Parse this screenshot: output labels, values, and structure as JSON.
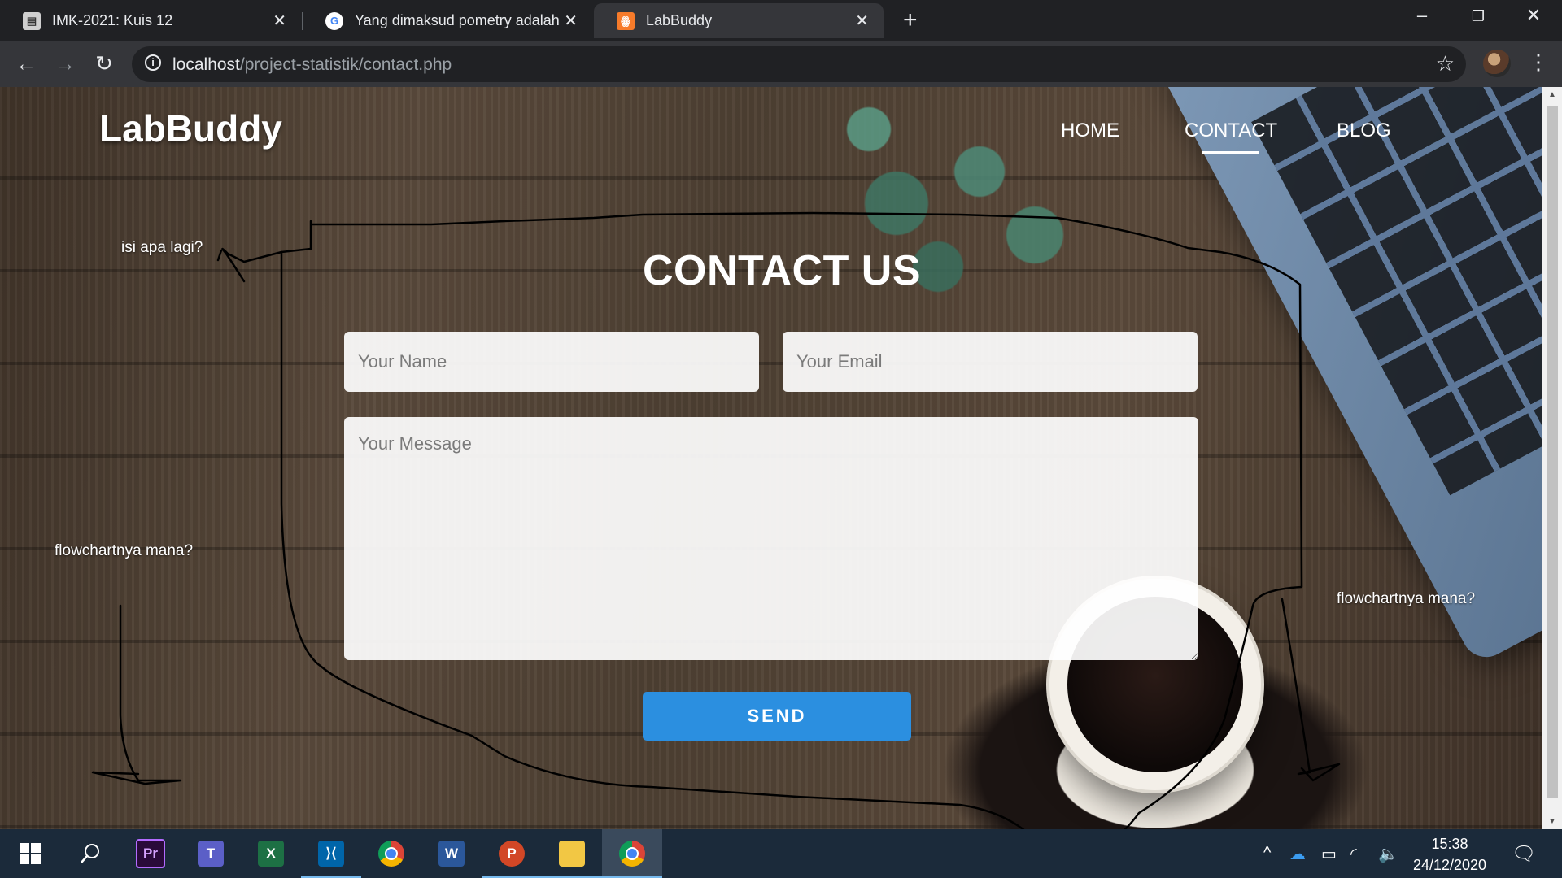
{
  "tabs": [
    {
      "title": "IMK-2021: Kuis 12",
      "favicon": "moodle-icon"
    },
    {
      "title": "Yang dimaksud pometry adalah :",
      "favicon": "google-icon"
    },
    {
      "title": "LabBuddy",
      "favicon": "xampp-icon",
      "active": true
    }
  ],
  "address": {
    "host": "localhost",
    "path": "/project-statistik/contact.php"
  },
  "site": {
    "brand": "LabBuddy",
    "nav": [
      {
        "label": "HOME"
      },
      {
        "label": "CONTACT",
        "active": true
      },
      {
        "label": "BLOG"
      }
    ],
    "title": "CONTACT US",
    "form": {
      "name_placeholder": "Your Name",
      "email_placeholder": "Your Email",
      "message_placeholder": "Your Message",
      "send_label": "SEND"
    }
  },
  "annotations": {
    "note1": "isi apa lagi?",
    "note2": "flowchartnya mana?",
    "note3": "flowchartnya mana?",
    "ink_color": "#000000"
  },
  "taskbar": {
    "apps": [
      "start-icon",
      "search-icon",
      "premiere-icon",
      "teams-icon",
      "excel-icon",
      "vscode-icon",
      "chrome-icon",
      "word-icon",
      "powerpoint-icon",
      "file-explorer-icon",
      "chrome-profile-icon"
    ],
    "time": "15:38",
    "date": "24/12/2020"
  },
  "colors": {
    "accent": "#2b8fe0",
    "chrome_dark": "#202124",
    "taskbar": "#1b2a3a"
  }
}
